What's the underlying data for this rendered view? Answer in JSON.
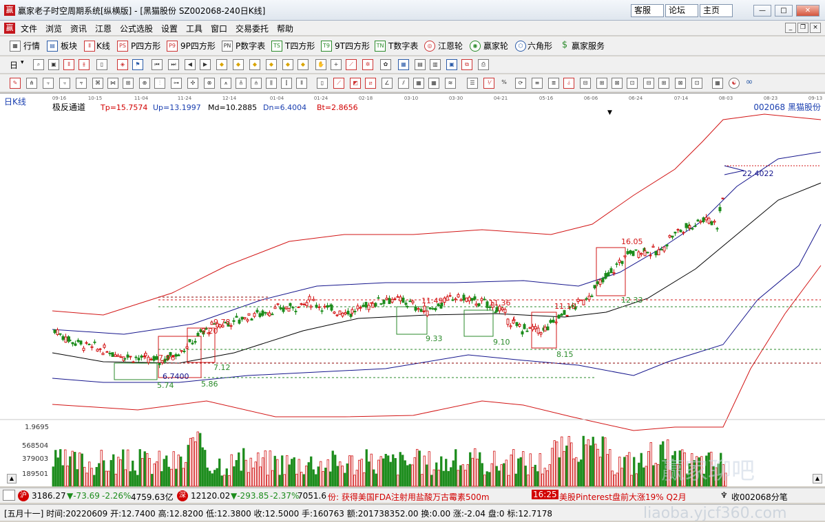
{
  "window": {
    "title": "赢家老子时空周期系统[纵横版] - [黑猫股份   SZ002068-240日K线]",
    "app_icon_text": "赢",
    "links": [
      "客服",
      "论坛",
      "主页"
    ],
    "controls": {
      "minimize": "—",
      "maximize": "□",
      "close": "✕"
    }
  },
  "menubar": {
    "icon_text": "赢",
    "items": [
      "文件",
      "浏览",
      "资讯",
      "江恩",
      "公式选股",
      "设置",
      "工具",
      "窗口",
      "交易委托",
      "帮助"
    ],
    "mdi": [
      "_",
      "❐",
      "×"
    ]
  },
  "toolbar1": {
    "items": [
      {
        "label": "行情",
        "icon": "grid-icon"
      },
      {
        "label": "板块",
        "icon": "blocks-icon"
      },
      {
        "label": "K线",
        "icon": "candles-icon"
      },
      {
        "label": "P四方形",
        "icon": "ps-icon",
        "badge": "PS"
      },
      {
        "label": "9P四方形",
        "icon": "9p-icon",
        "badge": "P9"
      },
      {
        "label": "P数字表",
        "icon": "pn-icon",
        "badge": "PN"
      },
      {
        "label": "T四方形",
        "icon": "ts-icon",
        "badge": "TS"
      },
      {
        "label": "9T四方形",
        "icon": "9t-icon",
        "badge": "T9"
      },
      {
        "label": "T数字表",
        "icon": "tn-icon",
        "badge": "TN"
      },
      {
        "label": "江恩轮",
        "icon": "gann-wheel-icon"
      },
      {
        "label": "赢家轮",
        "icon": "winner-wheel-icon"
      },
      {
        "label": "六角形",
        "icon": "hexagon-icon"
      },
      {
        "label": "赢家服务",
        "icon": "dollar-icon"
      }
    ]
  },
  "toolbar2": {
    "period_label": "日"
  },
  "chart": {
    "panel_label": "日K线",
    "indicator_name": "极反通道",
    "tp": "Tp=15.7574",
    "up": "Up=13.1997",
    "md": "Md=10.2885",
    "dn": "Dn=6.4004",
    "bt": "Bt=2.8656",
    "stock": "002068  黑猫股份",
    "dates": [
      "09-16",
      "10-15",
      "11-04",
      "11-24",
      "12-14",
      "01-04",
      "01-24",
      "02-18",
      "03-10",
      "03-30",
      "04-21",
      "05-16",
      "06-06",
      "06-24",
      "07-14",
      "08-03",
      "08-23",
      "09-13"
    ],
    "price_annotations": [
      "22.4022",
      "16.05",
      "12.33",
      "11.49",
      "11.36",
      "11.10",
      "9.78",
      "9.20",
      "9.33",
      "9.10",
      "8.15",
      "7.96",
      "7.12",
      "6.7400",
      "5.74",
      "5.86"
    ],
    "volume_labels": [
      "1.9695",
      "568504",
      "379003",
      "189501"
    ],
    "watermark": "赢家聊吧"
  },
  "status1": {
    "sh_icon": "沪",
    "sh_value": "3186.27",
    "sh_change": "▼-73.69",
    "sh_pct": "-2.26%",
    "sh_amount": "4759.63亿",
    "sz_icon": "深",
    "sz_value": "12120.02",
    "sz_change": "▼-293.85",
    "sz_pct": "-2.37%",
    "sz_amount": "7051.6",
    "news1": "份:  获得美国FDA注射用盐酸万古霉素500m",
    "news_time": "16:25",
    "news2": "美股Pinterest盘前大涨19% Q2月",
    "receive": "收002068分笔"
  },
  "status2": {
    "text": "[五月十一] 时间:20220609 开:12.7400 高:12.8200 低:12.3800 收:12.5000 手:160763 额:201738352.00 换:0.00 涨:-2.04 盘:0 标:12.7178",
    "watermark": "liaoba.yjcf360.com"
  }
}
